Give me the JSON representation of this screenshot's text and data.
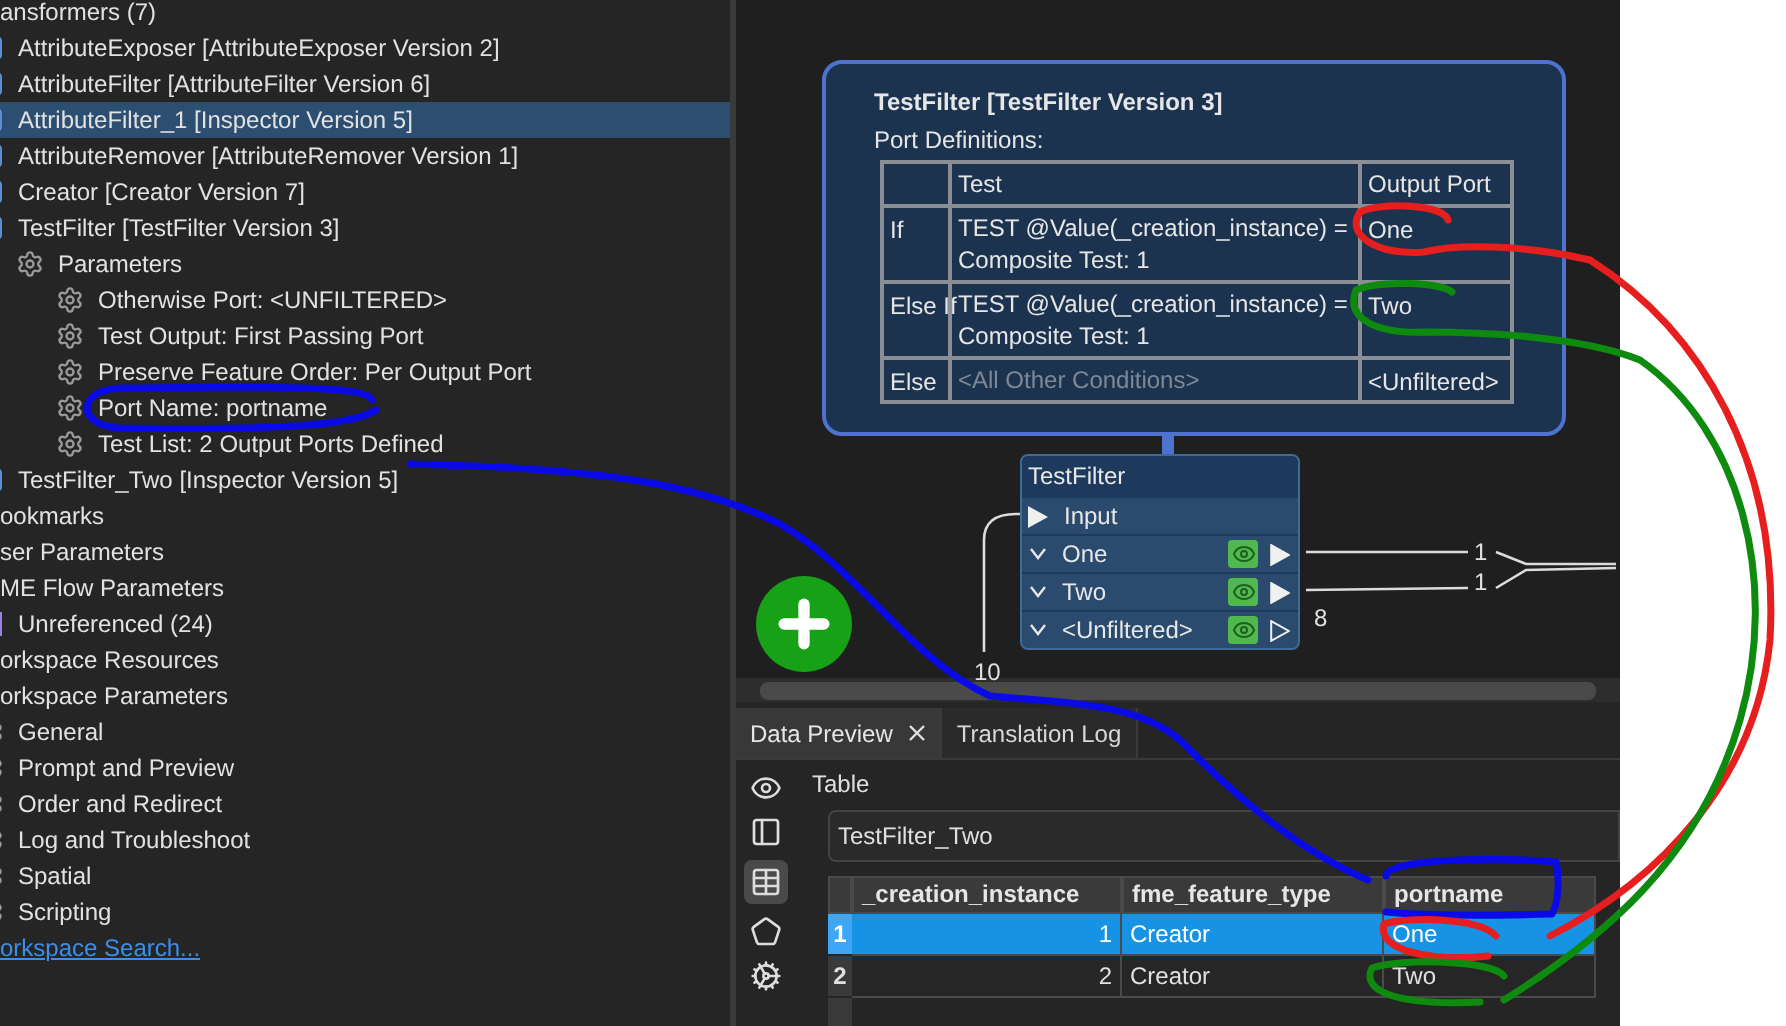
{
  "tree": [
    {
      "label": "ansformers (7)",
      "kind": "folder",
      "selected": false,
      "children": [
        {
          "label": "AttributeExposer [AttributeExposer Version 2]",
          "kind": "transformer",
          "selected": false
        },
        {
          "label": "AttributeFilter [AttributeFilter Version 6]",
          "kind": "transformer",
          "selected": false
        },
        {
          "label": "AttributeFilter_1 [Inspector Version 5]",
          "kind": "transformer",
          "selected": true
        },
        {
          "label": "AttributeRemover [AttributeRemover Version 1]",
          "kind": "transformer",
          "selected": false
        },
        {
          "label": "Creator [Creator Version 7]",
          "kind": "transformer",
          "selected": false
        },
        {
          "label": "TestFilter [TestFilter Version 3]",
          "kind": "transformer",
          "selected": false,
          "children": [
            {
              "label": "Parameters",
              "kind": "gear",
              "selected": false,
              "children": [
                {
                  "label": "Otherwise Port: <UNFILTERED>",
                  "kind": "gear",
                  "selected": false
                },
                {
                  "label": "Test Output: First Passing Port",
                  "kind": "gear",
                  "selected": false
                },
                {
                  "label": "Preserve Feature Order: Per Output Port",
                  "kind": "gear",
                  "selected": false
                },
                {
                  "label": "Port Name: portname",
                  "kind": "gear",
                  "selected": false
                },
                {
                  "label": "Test List: 2 Output Ports Defined",
                  "kind": "gear",
                  "selected": false
                }
              ]
            }
          ]
        },
        {
          "label": "TestFilter_Two [Inspector Version 5]",
          "kind": "transformer",
          "selected": false
        }
      ]
    },
    {
      "label": "ookmarks",
      "kind": "folder",
      "selected": false
    },
    {
      "label": "ser Parameters",
      "kind": "folder",
      "selected": false
    },
    {
      "label": "ME Flow Parameters",
      "kind": "folder",
      "selected": false,
      "children": [
        {
          "label": "Unreferenced (24)",
          "kind": "unreferenced",
          "selected": false
        }
      ]
    },
    {
      "label": "orkspace Resources",
      "kind": "folder",
      "selected": false
    },
    {
      "label": "orkspace Parameters",
      "kind": "folder",
      "selected": false,
      "children": [
        {
          "label": "General",
          "kind": "gear",
          "selected": false
        },
        {
          "label": "Prompt and Preview",
          "kind": "gear",
          "selected": false
        },
        {
          "label": "Order and Redirect",
          "kind": "gear",
          "selected": false
        },
        {
          "label": "Log and Troubleshoot",
          "kind": "gear",
          "selected": false
        },
        {
          "label": "Spatial",
          "kind": "gear",
          "selected": false
        },
        {
          "label": "Scripting",
          "kind": "gear",
          "selected": false
        }
      ]
    },
    {
      "label": "orkspace Search...",
      "kind": "link",
      "selected": false
    }
  ],
  "tooltip": {
    "title": "TestFilter [TestFilter Version 3]",
    "subtitle": "Port Definitions:",
    "columns": [
      "Test",
      "Output Port"
    ],
    "rows": [
      {
        "condition": "If",
        "test": [
          "TEST @Value(_creation_instance) =",
          "Composite Test: 1"
        ],
        "port": "One",
        "muted": false
      },
      {
        "condition": "Else If",
        "test": [
          "TEST @Value(_creation_instance) =",
          "Composite Test: 1"
        ],
        "port": "Two",
        "muted": false
      },
      {
        "condition": "Else",
        "test": [
          "<All Other Conditions>"
        ],
        "port": "<Unfiltered>",
        "muted": true
      }
    ]
  },
  "node": {
    "title": "TestFilter",
    "input": {
      "label": "Input",
      "count": "10"
    },
    "outputs": [
      {
        "label": "One",
        "connected": true,
        "count": "1"
      },
      {
        "label": "Two",
        "connected": true,
        "count": "1"
      },
      {
        "label": "<Unfiltered>",
        "connected": false,
        "count": "8"
      }
    ]
  },
  "panel": {
    "tabs": [
      {
        "label": "Data Preview",
        "selected": true,
        "closable": true
      },
      {
        "label": "Translation Log",
        "selected": false,
        "closable": false
      }
    ],
    "view_label": "Table",
    "source": "TestFilter_Two",
    "columns": [
      "_creation_instance",
      "fme_feature_type",
      "portname"
    ],
    "rows": [
      {
        "number": "1",
        "cells": [
          "1",
          "Creator",
          "One"
        ],
        "selected": true
      },
      {
        "number": "2",
        "cells": [
          "2",
          "Creator",
          "Two"
        ],
        "selected": false
      }
    ]
  }
}
